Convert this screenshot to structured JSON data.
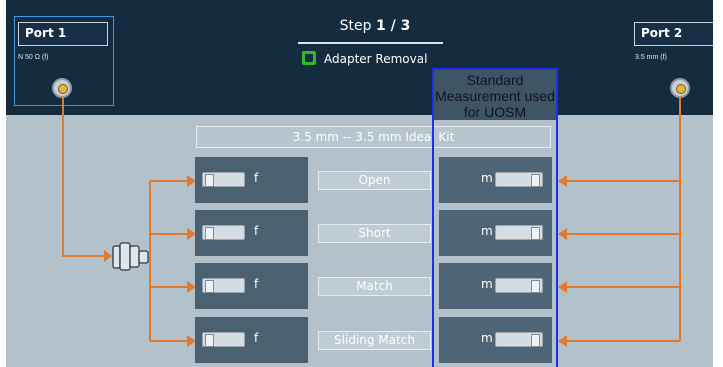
{
  "port1": {
    "name": "Port 1",
    "connector": "N 50 Ω (f)"
  },
  "port2": {
    "name": "Port 2",
    "connector": "3.5 mm (f)"
  },
  "step": {
    "prefix": "Step ",
    "number": "1 / 3",
    "task": "Adapter Removal"
  },
  "kit": {
    "label": "3.5 mm  -- 3.5 mm Ideal Kit"
  },
  "uosm": {
    "label": "Standard Measurement used for UOSM"
  },
  "standards": [
    {
      "name": "Open",
      "f_gender": "f",
      "m_gender": "m"
    },
    {
      "name": "Short",
      "f_gender": "f",
      "m_gender": "m"
    },
    {
      "name": "Match",
      "f_gender": "f",
      "m_gender": "m"
    },
    {
      "name": "Sliding Match",
      "f_gender": "f",
      "m_gender": "m"
    }
  ],
  "colors": {
    "link": "#e07a2e",
    "highlight_border": "#1d2fe8",
    "header_bg": "#152b40",
    "panel_bg": "#b2c1ca"
  },
  "icons": {
    "port_connector": "coax-port-icon",
    "adapter": "adapter-icon",
    "through_adapter": "adapter-body-icon"
  }
}
